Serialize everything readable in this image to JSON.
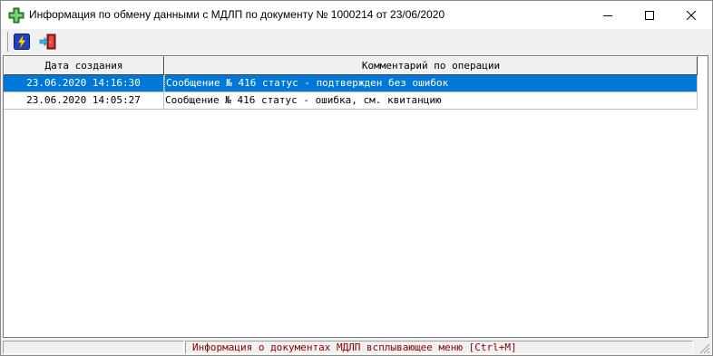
{
  "window": {
    "title": "Информация по обмену данными с МДЛП по документу № 1000214 от 23/06/2020",
    "app_icon": "green-cross-icon",
    "controls": {
      "minimize_icon": "minimize-icon",
      "maximize_icon": "maximize-icon",
      "close_icon": "close-icon"
    }
  },
  "toolbar": {
    "buttons": [
      {
        "icon": "lightning-icon",
        "accent": "#1f3fbf"
      },
      {
        "icon": "exit-door-icon",
        "accent": "#b22222"
      }
    ]
  },
  "grid": {
    "columns": [
      "Дата создания",
      "Комментарий по операции"
    ],
    "rows": [
      {
        "date": "23.06.2020 14:16:30",
        "comment": "Сообщение № 416 статус -  подтвержден без ошибок",
        "selected": true
      },
      {
        "date": "23.06.2020 14:05:27",
        "comment": "Сообщение № 416 статус -  ошибка, см. квитанцию",
        "selected": false
      }
    ],
    "selection_color": "#0078d7"
  },
  "status": {
    "left": "",
    "hint": "Информация о документах МДЛП всплывающее меню [Ctrl+M]",
    "hint_color": "#8b0000"
  }
}
